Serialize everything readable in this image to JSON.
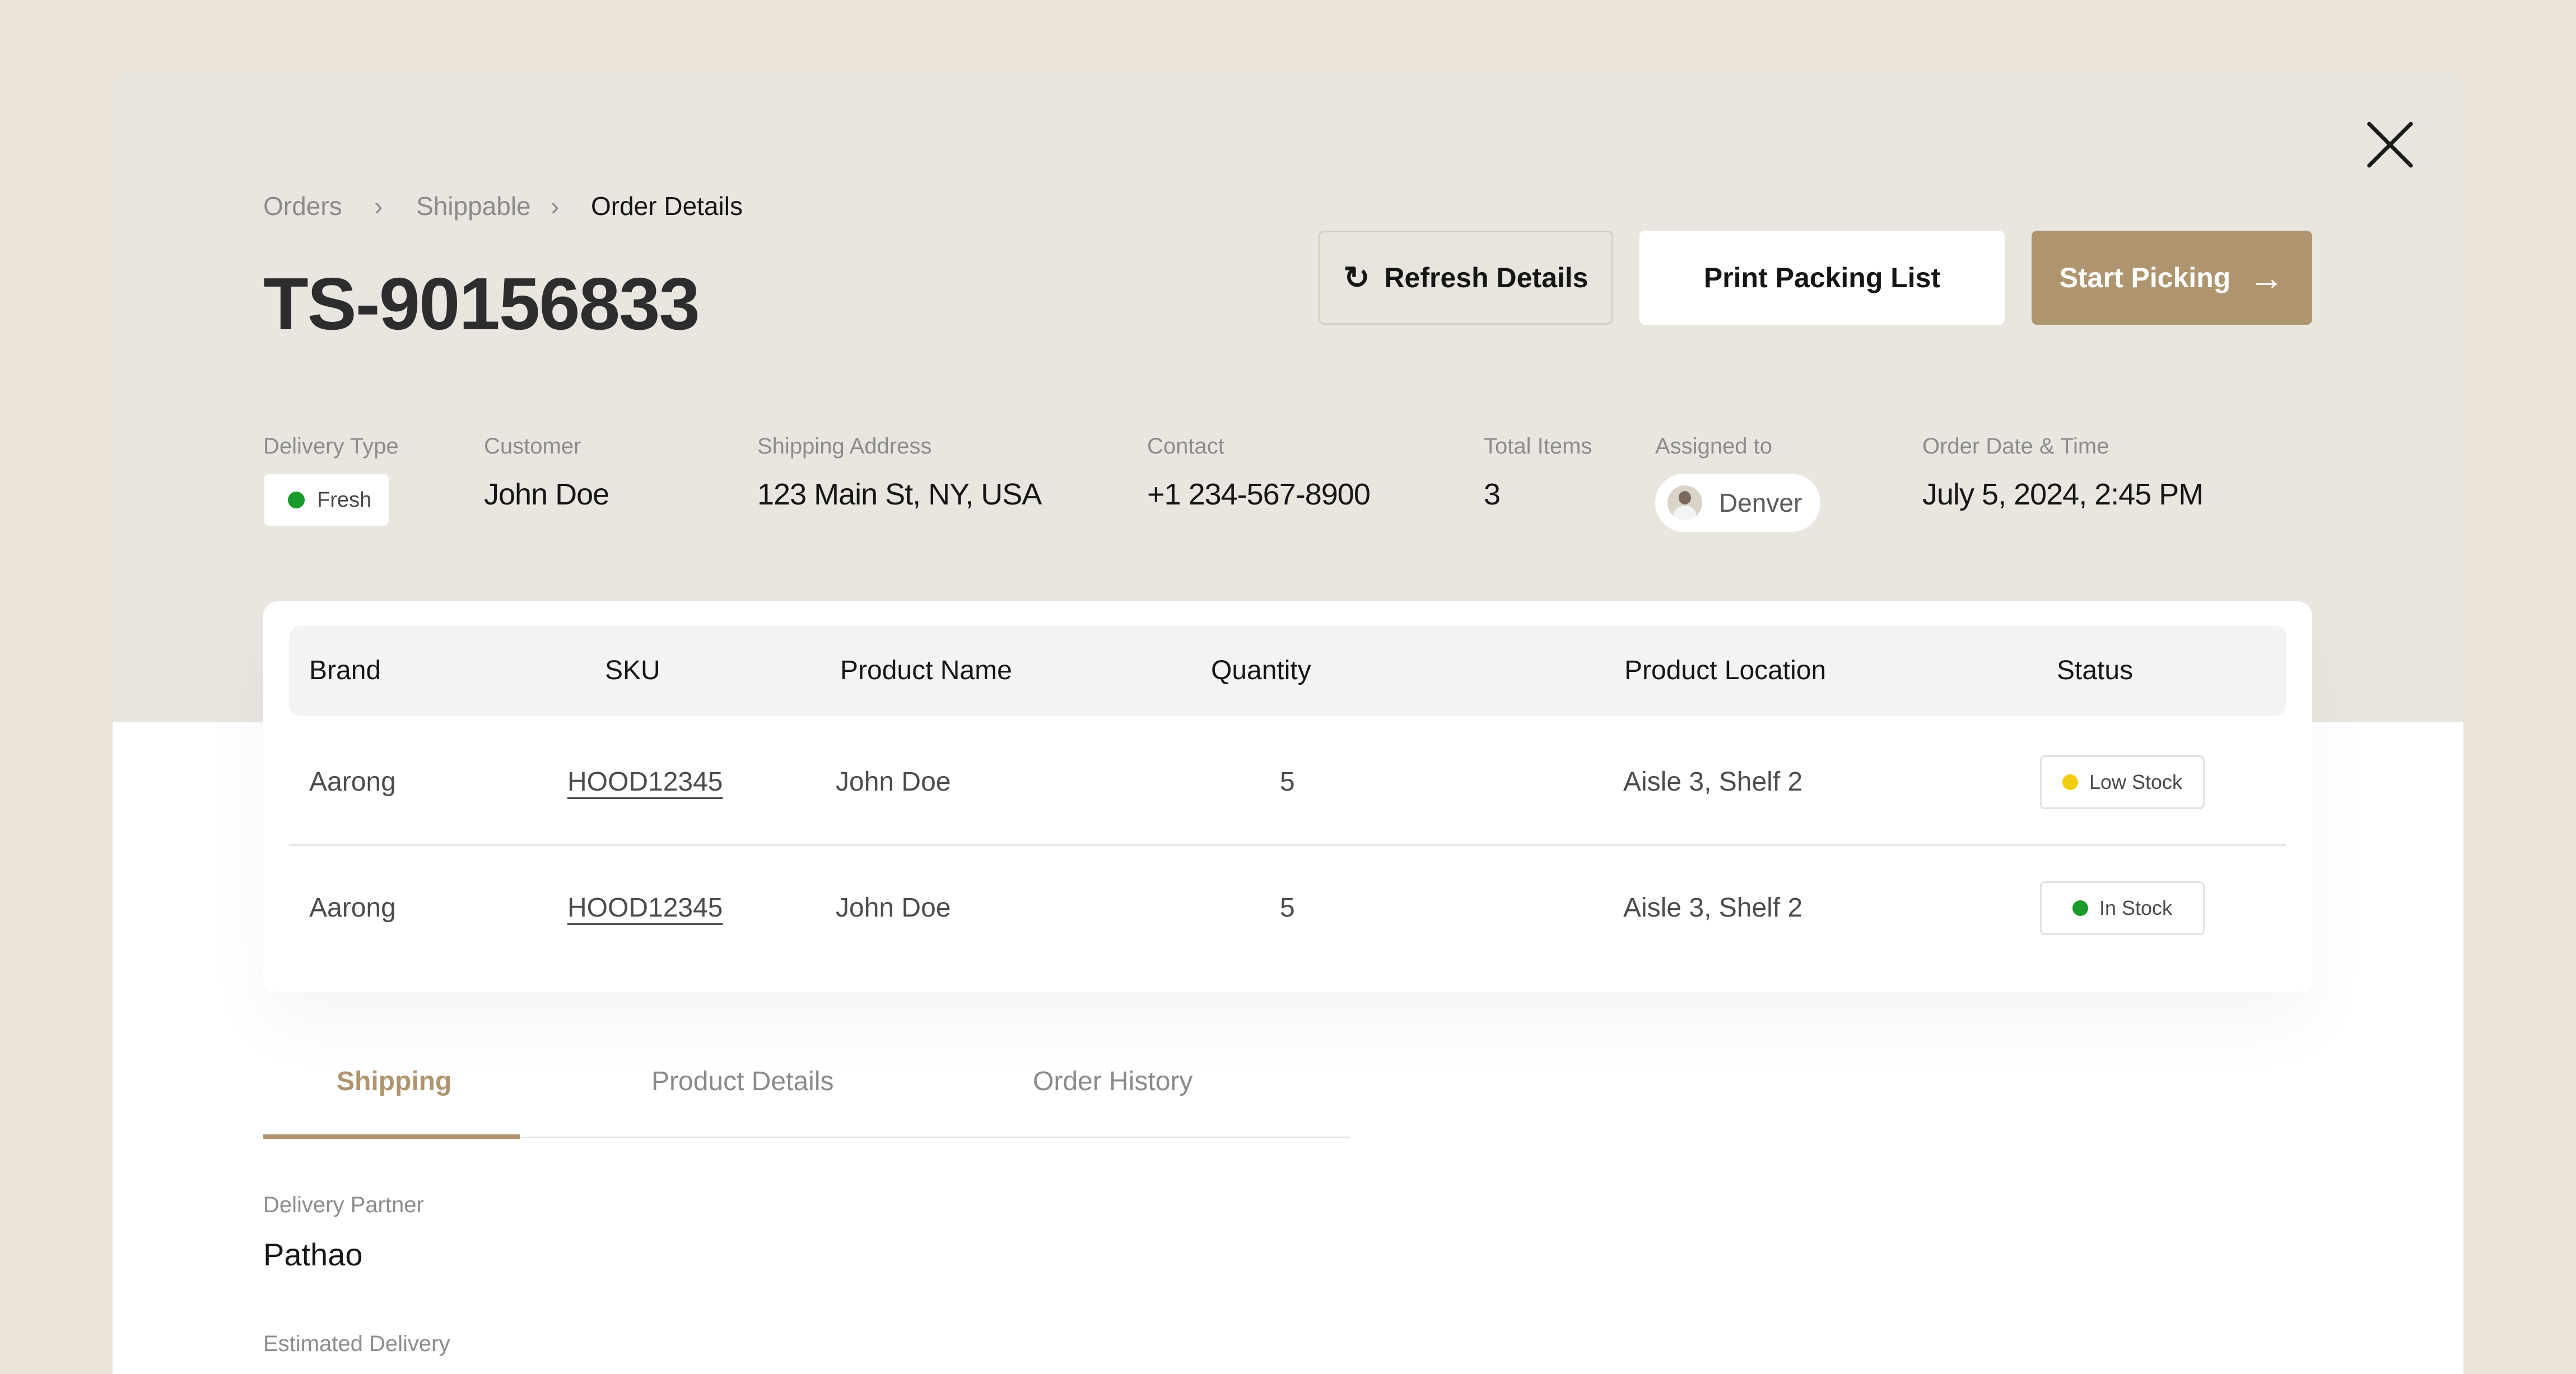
{
  "breadcrumb": [
    "Orders",
    "Shippable",
    "Order Details"
  ],
  "order_id": "TS-90156833",
  "actions": {
    "refresh": "Refresh Details",
    "print": "Print Packing List",
    "start": "Start Picking"
  },
  "meta": {
    "delivery_type": {
      "label": "Delivery Type",
      "value": "Fresh"
    },
    "customer": {
      "label": "Customer",
      "value": "John Doe"
    },
    "shipping_address": {
      "label": "Shipping Address",
      "value": "123 Main St, NY, USA"
    },
    "contact": {
      "label": "Contact",
      "value": "+1 234-567-8900"
    },
    "total_items": {
      "label": "Total Items",
      "value": "3"
    },
    "assigned_to": {
      "label": "Assigned to",
      "value": "Denver"
    },
    "order_date": {
      "label": "Order Date & Time",
      "value": "July 5, 2024, 2:45 PM"
    }
  },
  "table": {
    "columns": [
      "Brand",
      "SKU",
      "Product Name",
      "Quantity",
      "Product Location",
      "Status"
    ],
    "rows": [
      {
        "brand": "Aarong",
        "sku": "HOOD12345",
        "product": "John Doe",
        "quantity": "5",
        "location": "Aisle 3, Shelf 2",
        "status": "Low Stock"
      },
      {
        "brand": "Aarong",
        "sku": "HOOD12345",
        "product": "John Doe",
        "quantity": "5",
        "location": "Aisle 3, Shelf 2",
        "status": "In Stock"
      }
    ]
  },
  "tabs": [
    "Shipping",
    "Product Details",
    "Order History"
  ],
  "active_tab": "Shipping",
  "shipping": {
    "delivery_partner_label": "Delivery Partner",
    "delivery_partner": "Pathao",
    "estimated_delivery_label": "Estimated Delivery"
  },
  "colors": {
    "accent": "#ae9570",
    "fresh": "#1a9a2a",
    "low_stock": "#f2cc0f",
    "in_stock": "#1a9a2a"
  }
}
